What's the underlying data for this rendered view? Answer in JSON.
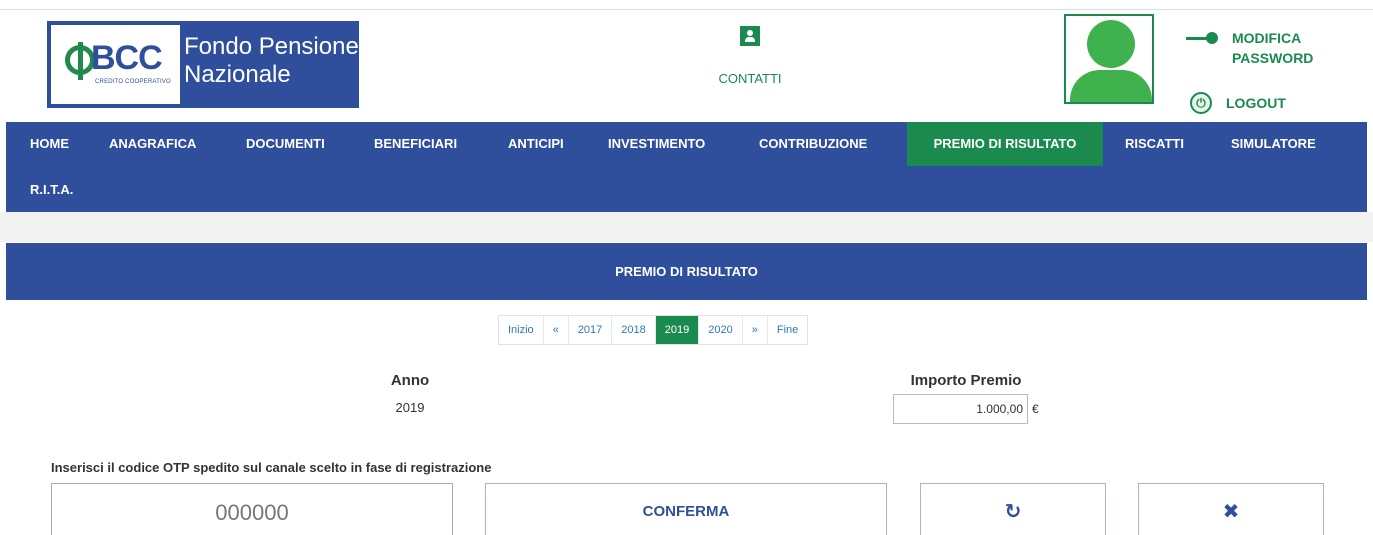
{
  "header": {
    "logo": {
      "brand": "BCC",
      "sub": "CREDITO COOPERATIVO",
      "title_line1": "Fondo Pensione",
      "title_line2": "Nazionale"
    },
    "contacts_label": "CONTATTI",
    "modify_password_label": "MODIFICA PASSWORD",
    "logout_label": "LOGOUT"
  },
  "nav": {
    "items": [
      {
        "label": "HOME"
      },
      {
        "label": "ANAGRAFICA"
      },
      {
        "label": "DOCUMENTI"
      },
      {
        "label": "BENEFICIARI"
      },
      {
        "label": "ANTICIPI"
      },
      {
        "label": "INVESTIMENTO"
      },
      {
        "label": "CONTRIBUZIONE"
      },
      {
        "label": "PREMIO DI RISULTATO",
        "active": true
      },
      {
        "label": "RISCATTI"
      },
      {
        "label": "SIMULATORE"
      },
      {
        "label": "R.I.T.A."
      }
    ]
  },
  "section": {
    "title": "PREMIO DI RISULTATO"
  },
  "pager": {
    "items": [
      "Inizio",
      "«",
      "2017",
      "2018",
      "2019",
      "2020",
      "»",
      "Fine"
    ],
    "active": "2019"
  },
  "summary": {
    "anno_label": "Anno",
    "anno_value": "2019",
    "importo_label": "Importo Premio",
    "importo_value": "1.000,00",
    "currency": "€"
  },
  "otp": {
    "label": "Inserisci il codice OTP spedito sul canale scelto in fase di registrazione",
    "placeholder": "000000",
    "confirm_label": "CONFERMA",
    "refresh_icon": "↻",
    "close_icon": "✖"
  },
  "colors": {
    "brand_blue": "#2f4f9d",
    "brand_green": "#1a8a4f"
  }
}
